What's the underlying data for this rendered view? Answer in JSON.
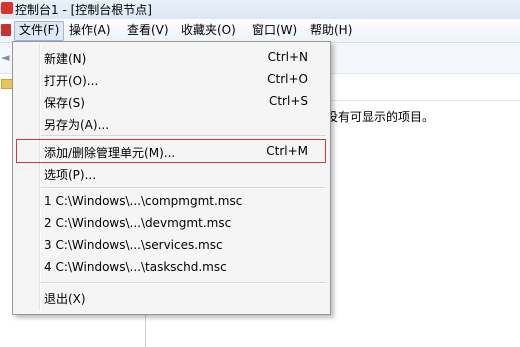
{
  "window": {
    "title": "控制台1 - [控制台根节点]"
  },
  "menubar": {
    "items": [
      {
        "label": "文件(F)",
        "active": true
      },
      {
        "label": "操作(A)"
      },
      {
        "label": "查看(V)"
      },
      {
        "label": "收藏夹(O)"
      },
      {
        "label": "窗口(W)"
      },
      {
        "label": "帮助(H)"
      }
    ]
  },
  "content": {
    "empty_message": "中没有可显示的项目。"
  },
  "file_menu": {
    "items": [
      {
        "label": "新建(N)",
        "shortcut": "Ctrl+N"
      },
      {
        "label": "打开(O)...",
        "shortcut": "Ctrl+O"
      },
      {
        "label": "保存(S)",
        "shortcut": "Ctrl+S"
      },
      {
        "label": "另存为(A)..."
      },
      {
        "label": "添加/删除管理单元(M)...",
        "shortcut": "Ctrl+M",
        "highlighted": true
      },
      {
        "label": "选项(P)..."
      },
      {
        "label": "1 C:\\Windows\\...\\compmgmt.msc"
      },
      {
        "label": "2 C:\\Windows\\...\\devmgmt.msc"
      },
      {
        "label": "3 C:\\Windows\\...\\services.msc"
      },
      {
        "label": "4 C:\\Windows\\...\\taskschd.msc"
      },
      {
        "label": "退出(X)"
      }
    ]
  },
  "colors": {
    "highlight_border": "#d23c3c",
    "menu_background": "#f5f5f5"
  }
}
